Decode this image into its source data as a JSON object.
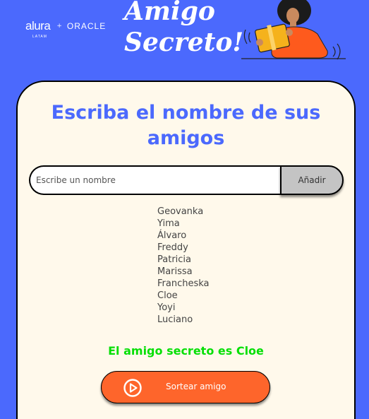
{
  "header": {
    "brand_alura": "alura",
    "brand_alura_sub": "LATAM",
    "brand_plus": "+",
    "brand_oracle": "ORACLE",
    "title_line1": "Amigo",
    "title_line2": "Secreto!"
  },
  "card": {
    "heading_line1": "Escriba el nombre de sus",
    "heading_line2": "amigos",
    "input_placeholder": "Escribe un nombre",
    "input_value": "",
    "add_label": "Añadir",
    "friends": [
      "Geovanka",
      "Yima",
      "Álvaro",
      "Freddy",
      "Patricia",
      "Marissa",
      "Francheska",
      "Cloe",
      "Yoyi",
      "Luciano"
    ],
    "result": "El amigo secreto es Cloe",
    "draw_label": "Sortear amigo"
  },
  "colors": {
    "background": "#4b69fd",
    "card": "#fff9eb",
    "heading": "#4b69fd",
    "add_button": "#c4c4c4",
    "draw_button": "#fe652b",
    "result": "#05df05"
  },
  "icons": {
    "draw_button_icon": "play-circle-icon",
    "illustration": "person-with-gift-illustration"
  }
}
